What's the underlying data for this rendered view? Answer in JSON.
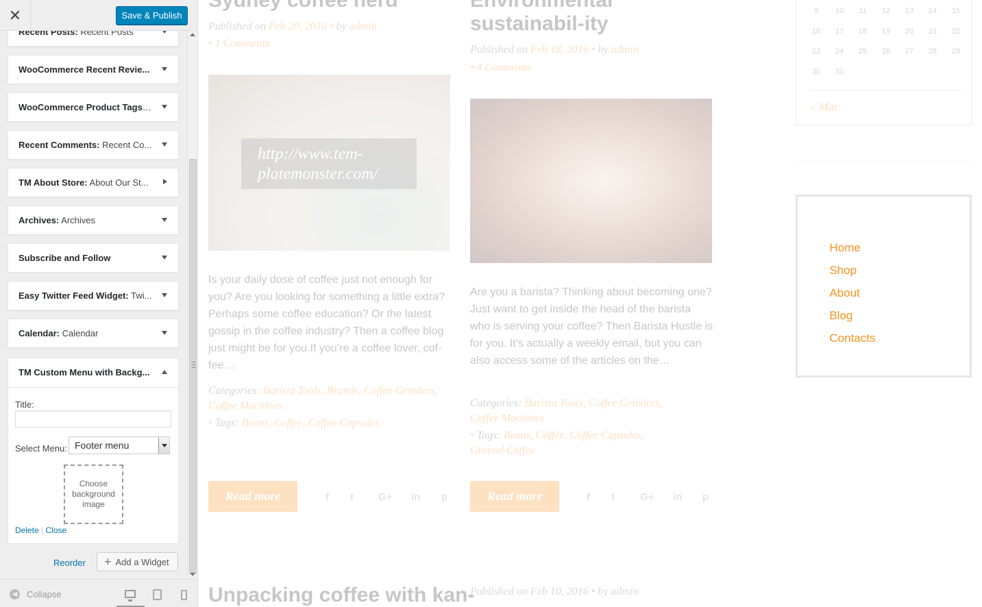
{
  "sidebar": {
    "close_icon": "close-icon",
    "publish_label": "Save & Publish",
    "widgets": [
      {
        "bold": "Recent Posts:",
        "sub": " Recent Posts",
        "arrow": "down"
      },
      {
        "bold": "WooCommerce Recent Revie...",
        "sub": "",
        "arrow": "down"
      },
      {
        "bold": "WooCommerce Product Tags:...",
        "sub": "",
        "arrow": "down"
      },
      {
        "bold": "Recent Comments:",
        "sub": " Recent Co...",
        "arrow": "down"
      },
      {
        "bold": "TM About Store:",
        "sub": " About Our St...",
        "arrow": "right"
      },
      {
        "bold": "Archives:",
        "sub": " Archives",
        "arrow": "down"
      },
      {
        "bold": "Subscribe and Follow",
        "sub": "",
        "arrow": "down"
      },
      {
        "bold": "Easy Twitter Feed Widget:",
        "sub": " Twi...",
        "arrow": "down"
      },
      {
        "bold": "Calendar:",
        "sub": " Calendar",
        "arrow": "down"
      }
    ],
    "open_widget": {
      "title": "TM Custom Menu with Backg...",
      "title_label": "Title:",
      "title_value": "",
      "menu_label": "Select Menu:",
      "menu_value": "Footer menu",
      "bg_label": "Choose background image",
      "delete_label": "Delete",
      "separator": "|",
      "close_label": "Close"
    },
    "reorder_label": "Reorder",
    "add_widget_label": "Add a Widget",
    "collapse_label": "Collapse"
  },
  "preview": {
    "posts": [
      {
        "title": "Sydney coffee herd",
        "meta_published": "Published on",
        "meta_date": "Feb 20, 2016",
        "meta_by": "by",
        "meta_author": "admin",
        "comments": "1 Comments",
        "image_caption": "http://www.tem-platemonster.com/",
        "excerpt": "Is your daily dose of coffee just not enough for you? Are you looking for something a little extra? Perhaps some coffee education? Or the latest gossip in the coffee industry? Then a coffee blog just might be for you.If you’re a coffee lover, cof-fee…",
        "categories_label": "Categories:",
        "categories": "Barista Tools, Brands, Coffee Grinders, Coffee Machines",
        "tags_label": "Tags:",
        "tags": "Beans, Coffee, Coffee Capsules",
        "read_more": "Read more"
      },
      {
        "title": "Environmental sustainabil-ity",
        "meta_published": "Published on",
        "meta_date": "Feb 18, 2016",
        "meta_by": "by",
        "meta_author": "admin",
        "comments": "4 Comments",
        "excerpt": "Are you a barista? Thinking about becoming one? Just want to get inside the head of the barista who is serving your coffee? Then Barista Hustle is for you. It’s actually a weekly email, but you can also access some of the articles on the…",
        "categories_label": "Categories:",
        "categories": "Barista Tools, Coffee Grinders, Coffee Machines",
        "tags_label": "Tags:",
        "tags": "Beans, Coffee, Coffee Capsules, Ground Coffee",
        "read_more": "Read more"
      }
    ],
    "next_post_title": "Unpacking coffee with kan-",
    "next_post_meta": "Published on Feb 10, 2016 • by admin",
    "social_icons": [
      "f",
      "t",
      "G+",
      "in",
      "p"
    ],
    "calendar": {
      "rows": [
        [
          "9",
          "10",
          "11",
          "12",
          "13",
          "14",
          "15"
        ],
        [
          "16",
          "17",
          "18",
          "19",
          "20",
          "21",
          "22"
        ],
        [
          "23",
          "24",
          "25",
          "26",
          "27",
          "28",
          "29"
        ],
        [
          "30",
          "31"
        ]
      ],
      "prev_label": "« Mar"
    },
    "menu_items": [
      "Home",
      "Shop",
      "About",
      "Blog",
      "Contacts"
    ],
    "accent_color": "#f7931e"
  }
}
